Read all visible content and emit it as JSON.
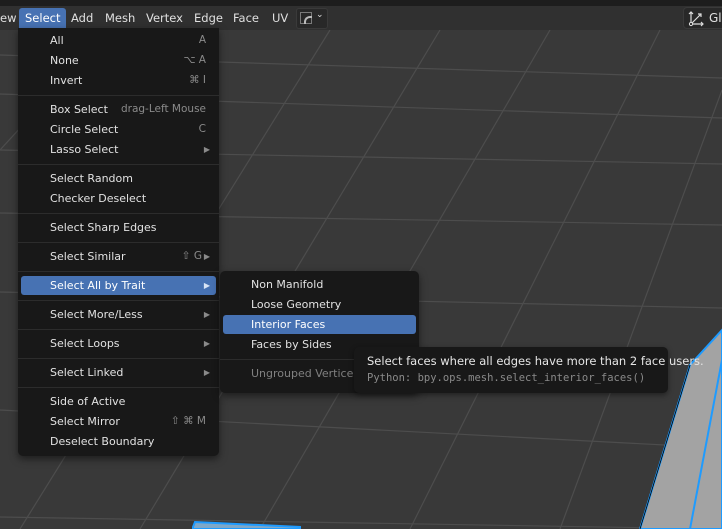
{
  "header": {
    "menus": [
      {
        "label": "ew",
        "active": false
      },
      {
        "label": "Select",
        "active": true
      },
      {
        "label": "Add",
        "active": false
      },
      {
        "label": "Mesh",
        "active": false
      },
      {
        "label": "Vertex",
        "active": false
      },
      {
        "label": "Edge",
        "active": false
      },
      {
        "label": "Face",
        "active": false
      },
      {
        "label": "UV",
        "active": false
      }
    ],
    "mode_dropdown_icon": "edge-select-mode-icon",
    "orientation_label": "Gl",
    "orientation_icon": "transform-orientation-icon"
  },
  "select_menu": {
    "items": [
      {
        "label": "All",
        "shortcut": "A"
      },
      {
        "label": "None",
        "shortcut": "⌥ A"
      },
      {
        "label": "Invert",
        "shortcut": "⌘ I"
      },
      {
        "label": "Box Select",
        "shortcut": "drag-Left Mouse"
      },
      {
        "label": "Circle Select",
        "shortcut": "C"
      },
      {
        "label": "Lasso Select",
        "submenu": true
      },
      {
        "label": "Select Random"
      },
      {
        "label": "Checker Deselect"
      },
      {
        "label": "Select Sharp Edges"
      },
      {
        "label": "Select Similar",
        "shortcut": "⇧ G",
        "submenu": true
      },
      {
        "label": "Select All by Trait",
        "submenu": true,
        "highlighted": true
      },
      {
        "label": "Select More/Less",
        "submenu": true
      },
      {
        "label": "Select Loops",
        "submenu": true
      },
      {
        "label": "Select Linked",
        "submenu": true
      },
      {
        "label": "Side of Active"
      },
      {
        "label": "Select Mirror",
        "shortcut": "⇧ ⌘ M"
      },
      {
        "label": "Deselect Boundary"
      }
    ]
  },
  "trait_submenu": {
    "items": [
      {
        "label": "Non Manifold"
      },
      {
        "label": "Loose Geometry"
      },
      {
        "label": "Interior Faces",
        "highlighted": true
      },
      {
        "label": "Faces by Sides"
      },
      {
        "label": "Ungrouped Vertices",
        "disabled": true
      }
    ]
  },
  "tooltip": {
    "description": "Select faces where all edges have more than 2 face users.",
    "python": "Python: bpy.ops.mesh.select_interior_faces()"
  },
  "colors": {
    "accent": "#4772b3",
    "menu_bg": "#181818",
    "viewport_bg": "#393939",
    "selection_outline": "#1e9bff",
    "mesh_face": "#a3a3a3"
  }
}
